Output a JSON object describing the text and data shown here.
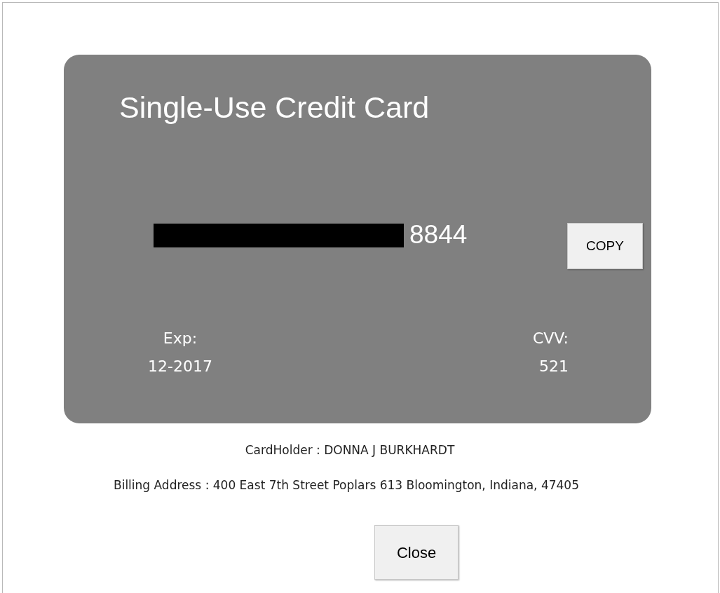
{
  "card": {
    "title": "Single-Use Credit Card",
    "number_last4": "8844",
    "copy_button": "COPY",
    "fields": [
      {
        "label": "Exp:",
        "value": "12-2017"
      },
      {
        "label": "CVV:",
        "value": "521"
      }
    ]
  },
  "cardholder": "CardHolder : DONNA J BURKHARDT",
  "billing_address": "Billing Address : 400 East 7th Street Poplars 613 Bloomington, Indiana, 47405",
  "buttons": [
    "Close"
  ]
}
